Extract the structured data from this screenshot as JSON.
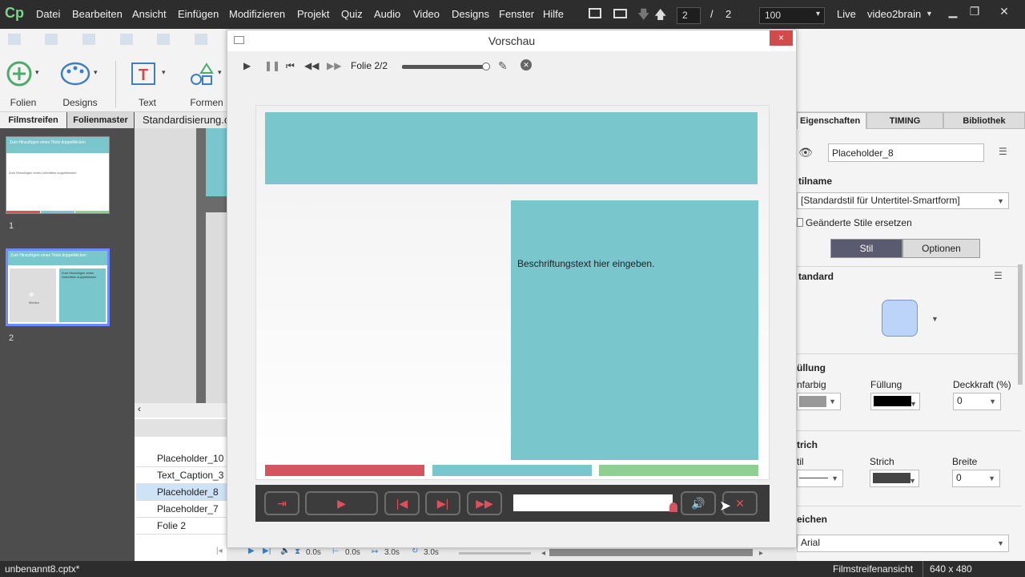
{
  "menubar": {
    "logo": "Cp",
    "items": [
      "Datei",
      "Bearbeiten",
      "Ansicht",
      "Einfügen",
      "Modifizieren",
      "Projekt",
      "Quiz",
      "Audio",
      "Video",
      "Designs",
      "Fenster",
      "Hilfe"
    ],
    "slide_current": "2",
    "slide_sep": "/",
    "slide_total": "2",
    "zoom": "100",
    "live_label": "Live",
    "user": "video2brain"
  },
  "toolbar": {
    "folien": "Folien",
    "designs": "Designs",
    "text": "Text",
    "formen": "Formen"
  },
  "left": {
    "tab_filmstrip": "Filmstreifen",
    "tab_master": "Folienmaster",
    "stage_tab": "Standardisierung.c",
    "slide1_title": "Zum Hinzufügen eines Titels doppelklicken",
    "slide1_subtitle": "Zum Hinzufügen eines Untertitels doppelklicken",
    "slide2_title": "Zum Hinzufügen eines Titels doppelklicken",
    "slide2_text": "Zum Hinzufügen eines Untertitels doppelklicken",
    "slide2_media": "Medien",
    "num1": "1",
    "num2": "2"
  },
  "timeline": {
    "rows": [
      "Placeholder_10",
      "Text_Caption_3",
      "Placeholder_8",
      "Placeholder_7",
      "Folie 2"
    ],
    "t1": "0.0s",
    "t2": "0.0s",
    "t3": "3.0s",
    "t4": "3.0s"
  },
  "preview": {
    "title": "Vorschau",
    "close": "×",
    "slide_label": "Folie 2/2",
    "caption": "Beschriftungstext hier eingeben.",
    "progress_fraction": 1.0,
    "colors": {
      "teal": "#79c6cd",
      "red": "#d4545f",
      "green": "#8fcf94",
      "dark": "#3a3a3a"
    }
  },
  "right": {
    "tab_props": "Eigenschaften",
    "tab_timing": "TIMING",
    "tab_library": "Bibliothek",
    "object_name": "Placeholder_8",
    "style_name_label": "tilname",
    "style_value": "[Standardstil für Untertitel-Smartform]",
    "replace_label": "Geänderte Stile ersetzen",
    "seg_style": "Stil",
    "seg_options": "Optionen",
    "standard_label": "tandard",
    "fill_section": "üllung",
    "fill_type_label": "nfarbig",
    "fill_label": "Füllung",
    "opacity_label": "Deckkraft (%)",
    "opacity_value": "0",
    "stroke_section": "trich",
    "stroke_style_label": "til",
    "stroke_label": "Strich",
    "width_label": "Breite",
    "width_value": "0",
    "font_section": "eichen",
    "font_value": "Arial"
  },
  "status": {
    "file": "unbenannt8.cptx*",
    "view": "Filmstreifenansicht",
    "size": "640 x 480"
  }
}
